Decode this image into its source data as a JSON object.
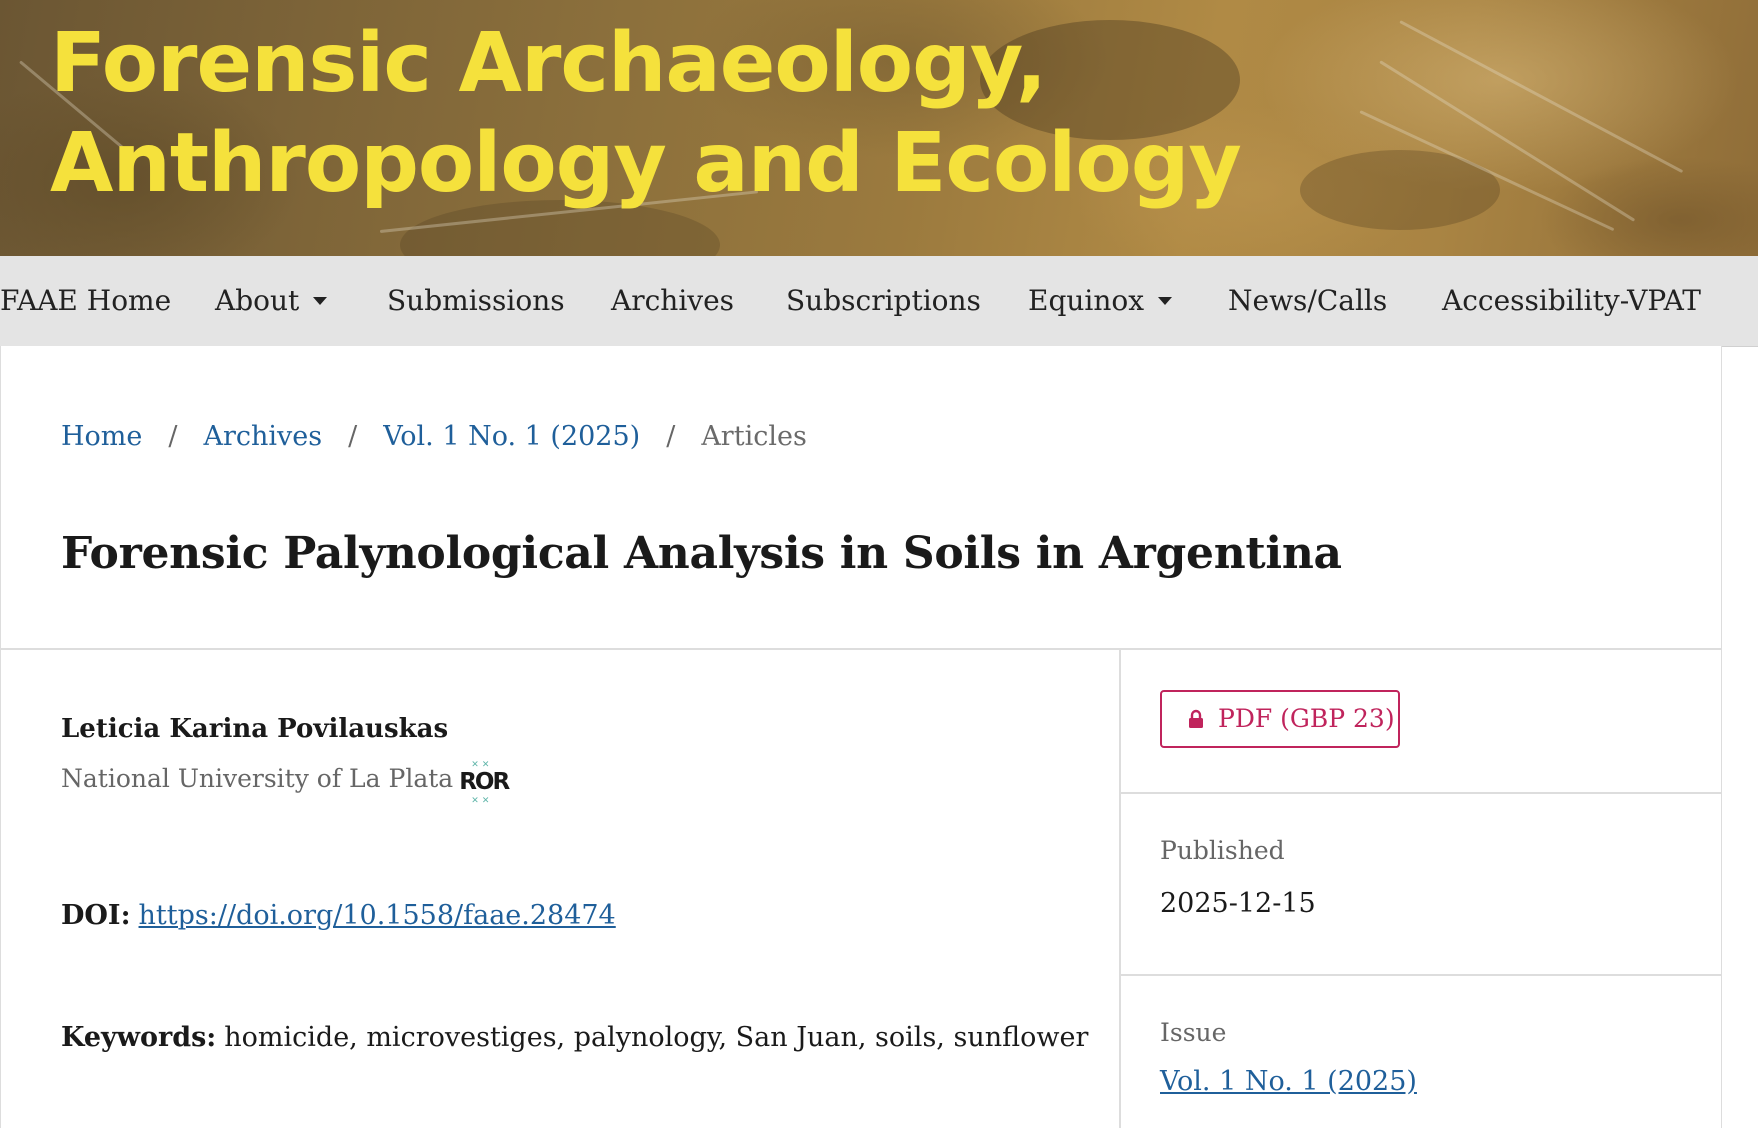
{
  "header": {
    "title_line1": "Forensic Archaeology,",
    "title_line2": "Anthropology and Ecology",
    "title_color": "#f5e13c"
  },
  "nav": {
    "items": [
      {
        "label": "FAAE Home",
        "dropdown": false
      },
      {
        "label": "About",
        "dropdown": true
      },
      {
        "label": "Submissions",
        "dropdown": false
      },
      {
        "label": "Archives",
        "dropdown": false
      },
      {
        "label": "Subscriptions",
        "dropdown": false
      },
      {
        "label": "Equinox",
        "dropdown": true
      },
      {
        "label": "News/Calls",
        "dropdown": false
      },
      {
        "label": "Accessibility-VPAT",
        "dropdown": false
      }
    ]
  },
  "breadcrumb": {
    "items": [
      "Home",
      "Archives",
      "Vol. 1 No. 1 (2025)"
    ],
    "current": "Articles",
    "separator": "/"
  },
  "article": {
    "title": "Forensic Palynological Analysis in Soils in Argentina",
    "author": "Leticia Karina Povilauskas",
    "affiliation": "National University of La Plata",
    "ror_logo": "ROR",
    "doi_label": "DOI:",
    "doi_url": "https://doi.org/10.1558/faae.28474",
    "keywords_label": "Keywords:",
    "keywords": "homicide, microvestiges, palynology, San Juan, soils, sunflower"
  },
  "sidebar": {
    "pdf_button": "PDF (GBP 23)",
    "pdf_icon": "lock-icon",
    "published_label": "Published",
    "published_date": "2025-12-15",
    "issue_label": "Issue",
    "issue_value": "Vol. 1 No. 1 (2025)"
  },
  "colors": {
    "link": "#1f5f9a",
    "accent": "#c0245c",
    "nav_bg": "#e4e4e4"
  }
}
